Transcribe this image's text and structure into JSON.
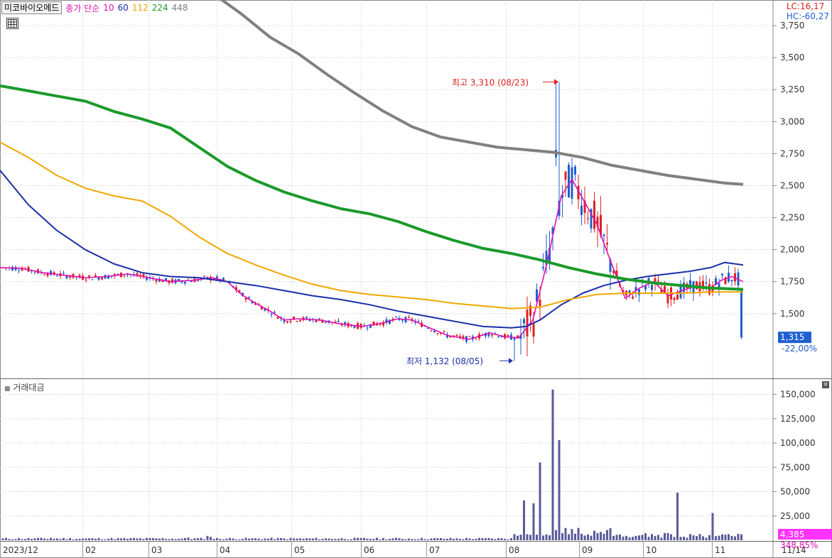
{
  "header": {
    "ticker": "미코바이오메드",
    "indicator": "종가 단순",
    "ma": [
      {
        "period": "10",
        "color": "#e010b0"
      },
      {
        "period": "60",
        "color": "#1a2fa8"
      },
      {
        "period": "112",
        "color": "#f0a800"
      },
      {
        "period": "224",
        "color": "#1a9a2a"
      },
      {
        "period": "448",
        "color": "#808080"
      }
    ],
    "lc": "LC:16,17",
    "hc": "HC:-60,27"
  },
  "volume_panel": {
    "title": "거래대금",
    "close_icon": "close-icon"
  },
  "colors": {
    "up": "#e02020",
    "down": "#1f5fd0",
    "volume": "#5a5a9a",
    "grid": "#c8c8c8",
    "price_tag_bg": "#1f5fd0",
    "volume_tag_bg": "#ff33ff"
  },
  "chart_data": [
    {
      "type": "candlestick",
      "title": "미코바이오메드",
      "x": [
        "2023/12",
        "02",
        "03",
        "04",
        "05",
        "06",
        "07",
        "08",
        "09",
        "10",
        "11",
        "11/14"
      ],
      "ylim": [
        1000,
        3950
      ],
      "y_ticks": [
        "3,750",
        "3,500",
        "3,250",
        "3,000",
        "2,750",
        "2,500",
        "2,250",
        "2,000",
        "1,750",
        "1,500"
      ],
      "y_tick_values": [
        3750,
        3500,
        3250,
        3000,
        2750,
        2500,
        2250,
        2000,
        1750,
        1500
      ],
      "last_price": "1,315",
      "last_change": "-22,00%",
      "annotations": [
        {
          "text": "최고 3,310 (08/23)",
          "value": 3310,
          "date": "08/23"
        },
        {
          "text": "최저 1,132 (08/05)",
          "value": 1132,
          "date": "08/05"
        }
      ],
      "series": [
        {
          "name": "10",
          "values": [
            [
              0,
              1860
            ],
            [
              30,
              1855
            ],
            [
              60,
              1820
            ],
            [
              90,
              1800
            ],
            [
              120,
              1780
            ],
            [
              150,
              1790
            ],
            [
              180,
              1810
            ],
            [
              210,
              1780
            ],
            [
              240,
              1750
            ],
            [
              270,
              1760
            ],
            [
              300,
              1780
            ],
            [
              320,
              1750
            ],
            [
              340,
              1650
            ],
            [
              360,
              1580
            ],
            [
              380,
              1520
            ],
            [
              400,
              1450
            ],
            [
              420,
              1460
            ],
            [
              450,
              1450
            ],
            [
              480,
              1420
            ],
            [
              510,
              1400
            ],
            [
              540,
              1430
            ],
            [
              560,
              1460
            ],
            [
              580,
              1450
            ],
            [
              600,
              1400
            ],
            [
              630,
              1330
            ],
            [
              660,
              1300
            ],
            [
              690,
              1350
            ],
            [
              710,
              1320
            ],
            [
              730,
              1310
            ],
            [
              750,
              1450
            ],
            [
              770,
              1900
            ],
            [
              790,
              2420
            ],
            [
              805,
              2550
            ],
            [
              820,
              2400
            ],
            [
              840,
              2200
            ],
            [
              860,
              1900
            ],
            [
              880,
              1620
            ],
            [
              900,
              1700
            ],
            [
              920,
              1750
            ],
            [
              940,
              1640
            ],
            [
              960,
              1680
            ],
            [
              980,
              1720
            ],
            [
              1000,
              1700
            ],
            [
              1015,
              1760
            ],
            [
              1030,
              1790
            ],
            [
              1046,
              1750
            ]
          ]
        },
        {
          "name": "60",
          "values": [
            [
              0,
              2620
            ],
            [
              40,
              2350
            ],
            [
              80,
              2150
            ],
            [
              120,
              2000
            ],
            [
              160,
              1890
            ],
            [
              200,
              1820
            ],
            [
              240,
              1790
            ],
            [
              280,
              1780
            ],
            [
              320,
              1750
            ],
            [
              360,
              1720
            ],
            [
              400,
              1680
            ],
            [
              440,
              1640
            ],
            [
              480,
              1610
            ],
            [
              520,
              1570
            ],
            [
              560,
              1520
            ],
            [
              600,
              1480
            ],
            [
              640,
              1440
            ],
            [
              680,
              1400
            ],
            [
              720,
              1390
            ],
            [
              740,
              1400
            ],
            [
              760,
              1450
            ],
            [
              790,
              1570
            ],
            [
              820,
              1660
            ],
            [
              850,
              1720
            ],
            [
              880,
              1760
            ],
            [
              910,
              1790
            ],
            [
              940,
              1810
            ],
            [
              970,
              1830
            ],
            [
              1000,
              1860
            ],
            [
              1020,
              1900
            ],
            [
              1046,
              1880
            ]
          ]
        },
        {
          "name": "112",
          "values": [
            [
              0,
              2840
            ],
            [
              40,
              2720
            ],
            [
              80,
              2580
            ],
            [
              120,
              2480
            ],
            [
              160,
              2420
            ],
            [
              200,
              2380
            ],
            [
              240,
              2260
            ],
            [
              280,
              2100
            ],
            [
              320,
              1970
            ],
            [
              360,
              1880
            ],
            [
              400,
              1800
            ],
            [
              440,
              1730
            ],
            [
              480,
              1680
            ],
            [
              520,
              1650
            ],
            [
              560,
              1630
            ],
            [
              600,
              1610
            ],
            [
              640,
              1580
            ],
            [
              680,
              1560
            ],
            [
              720,
              1540
            ],
            [
              760,
              1550
            ],
            [
              800,
              1610
            ],
            [
              840,
              1650
            ],
            [
              880,
              1660
            ],
            [
              920,
              1660
            ],
            [
              960,
              1660
            ],
            [
              1000,
              1670
            ],
            [
              1046,
              1670
            ]
          ]
        },
        {
          "name": "224",
          "values": [
            [
              0,
              3280
            ],
            [
              40,
              3240
            ],
            [
              80,
              3200
            ],
            [
              120,
              3160
            ],
            [
              160,
              3080
            ],
            [
              200,
              3020
            ],
            [
              240,
              2950
            ],
            [
              280,
              2800
            ],
            [
              320,
              2650
            ],
            [
              360,
              2540
            ],
            [
              400,
              2450
            ],
            [
              440,
              2380
            ],
            [
              480,
              2320
            ],
            [
              520,
              2280
            ],
            [
              560,
              2220
            ],
            [
              600,
              2140
            ],
            [
              640,
              2070
            ],
            [
              680,
              2010
            ],
            [
              720,
              1970
            ],
            [
              760,
              1920
            ],
            [
              800,
              1860
            ],
            [
              840,
              1810
            ],
            [
              880,
              1770
            ],
            [
              920,
              1740
            ],
            [
              960,
              1720
            ],
            [
              1000,
              1700
            ],
            [
              1046,
              1690
            ]
          ]
        },
        {
          "name": "448",
          "values": [
            [
              300,
              4000
            ],
            [
              340,
              3840
            ],
            [
              380,
              3660
            ],
            [
              420,
              3530
            ],
            [
              460,
              3370
            ],
            [
              500,
              3220
            ],
            [
              540,
              3080
            ],
            [
              580,
              2960
            ],
            [
              620,
              2880
            ],
            [
              660,
              2840
            ],
            [
              700,
              2800
            ],
            [
              740,
              2780
            ],
            [
              780,
              2760
            ],
            [
              820,
              2720
            ],
            [
              860,
              2660
            ],
            [
              900,
              2620
            ],
            [
              940,
              2580
            ],
            [
              980,
              2550
            ],
            [
              1020,
              2520
            ],
            [
              1046,
              2510
            ]
          ]
        }
      ],
      "candles_note": "daily OHLC series (approximate)"
    },
    {
      "type": "bar",
      "title": "거래대금",
      "ylim": [
        0,
        165000
      ],
      "y_ticks": [
        "150,000",
        "125,000",
        "100,000",
        "75,000",
        "50,000",
        "25,000"
      ],
      "y_tick_values": [
        150000,
        125000,
        100000,
        75000,
        50000,
        25000
      ],
      "last_value": "4,385",
      "last_change": "348,85%",
      "spikes": [
        {
          "x": 737,
          "value": 41000
        },
        {
          "x": 749,
          "value": 38000
        },
        {
          "x": 762,
          "value": 80000
        },
        {
          "x": 780,
          "value": 155000
        },
        {
          "x": 786,
          "value": 103000
        },
        {
          "x": 952,
          "value": 49000
        },
        {
          "x": 1005,
          "value": 28000
        }
      ]
    }
  ]
}
